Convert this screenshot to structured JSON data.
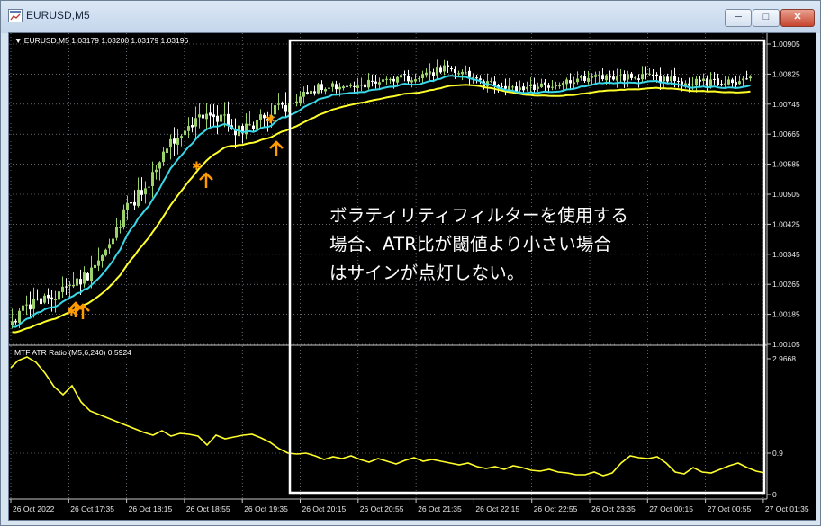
{
  "window": {
    "title": "EURUSD,M5",
    "min_glyph": "─",
    "max_glyph": "□",
    "close_glyph": "✕"
  },
  "main_chart": {
    "symbol_label": "EURUSD,M5",
    "ohlc_text": "1.03179 1.03200 1.03179 1.03196",
    "price_scale": [
      "1.00905",
      "1.00825",
      "1.00745",
      "1.00665",
      "1.00585",
      "1.00505",
      "1.00425",
      "1.00345",
      "1.00265",
      "1.00185",
      "1.00105"
    ],
    "signals_shown": 4
  },
  "indicator": {
    "label": "MTF ATR Ratio",
    "params": "(M5,6,240)",
    "value": "0.5924",
    "scale": [
      "2.9668",
      "0.9",
      "0"
    ]
  },
  "time_axis": [
    "26 Oct 2022",
    "26 Oct 17:35",
    "26 Oct 18:15",
    "26 Oct 18:55",
    "26 Oct 19:35",
    "26 Oct 20:15",
    "26 Oct 20:55",
    "26 Oct 21:35",
    "26 Oct 22:15",
    "26 Oct 22:55",
    "26 Oct 23:35",
    "27 Oct 00:15",
    "27 Oct 00:55",
    "27 Oct 01:35"
  ],
  "annotation": {
    "line1": "ボラティリティフィルターを使用する",
    "line2": "場合、ATR比が閾値より小さい場合",
    "line3": "はサインが点灯しない。"
  },
  "colors": {
    "background": "#000000",
    "bull_candle": "#9bd36a",
    "bear_candle": "#ffffff",
    "fast_ma": "#38d8e8",
    "slow_ma": "#ffff2a",
    "signal": "#ff9a00",
    "atr_ratio": "#ffff2a",
    "grid": "#9aa6b4",
    "highlight_box": "#ffffff"
  }
}
